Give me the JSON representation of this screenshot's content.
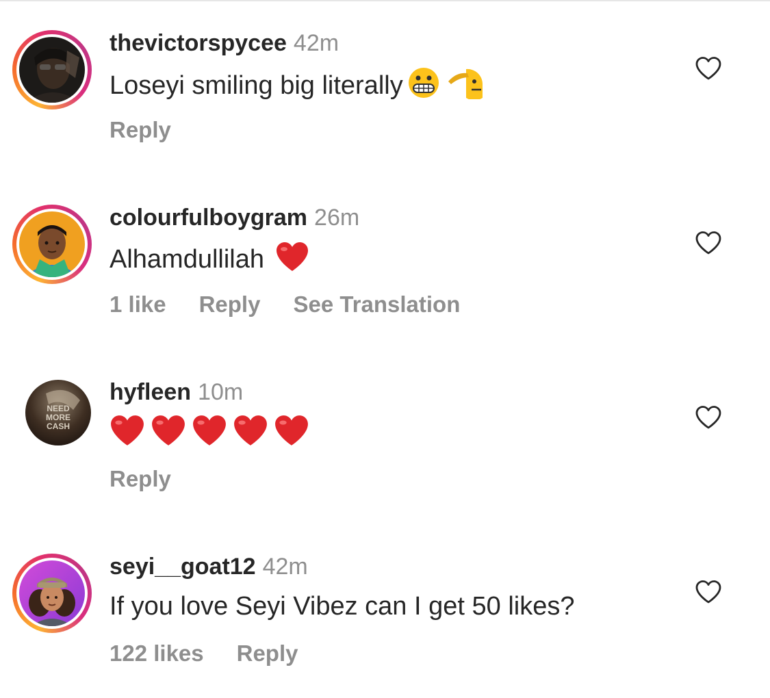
{
  "comments": [
    {
      "username": "thevictorspycee",
      "time": "42m",
      "text": "Loseyi smiling big literally",
      "emojis": [
        "grimacing-face",
        "saluting-face"
      ],
      "likes": "",
      "reply": "Reply",
      "avatar_ring": true
    },
    {
      "username": "colourfulboygram",
      "time": "26m",
      "text": "Alhamdullilah",
      "emojis": [
        "red-heart"
      ],
      "likes": "1 like",
      "reply": "Reply",
      "translation": "See Translation",
      "avatar_ring": true
    },
    {
      "username": "hyfleen",
      "time": "10m",
      "text": "",
      "emojis": [
        "red-heart",
        "red-heart",
        "red-heart",
        "red-heart",
        "red-heart"
      ],
      "likes": "",
      "reply": "Reply",
      "avatar_ring": false,
      "avatar_text": "NEED MORE CASH"
    },
    {
      "username": "seyi__goat12",
      "time": "42m",
      "text": "If you love Seyi Vibez can I get 50 likes?",
      "emojis": [],
      "likes": "122 likes",
      "reply": "Reply",
      "avatar_ring": true
    }
  ],
  "colors": {
    "text": "#262626",
    "secondary": "#8e8e8e",
    "heart_emoji": "#e0262b"
  }
}
